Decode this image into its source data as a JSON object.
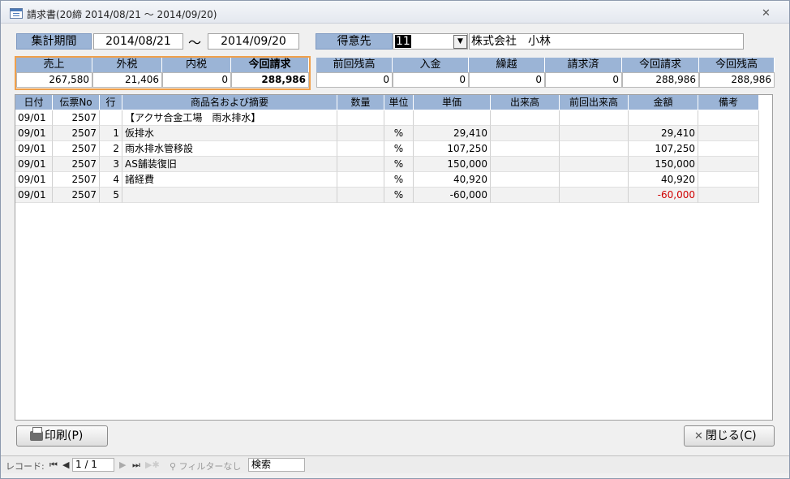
{
  "window": {
    "title": "請求書(20締 2014/08/21 ～ 2014/09/20)",
    "close_glyph": "✕"
  },
  "period": {
    "label": "集計期間",
    "from": "2014/08/21",
    "separator": "～",
    "to": "2014/09/20"
  },
  "customer": {
    "label": "得意先",
    "code": "11",
    "name": "株式会社　小林"
  },
  "summary_left": {
    "headers": [
      "売上",
      "外税",
      "内税",
      "今回請求"
    ],
    "values": [
      "267,580",
      "21,406",
      "0",
      "288,986"
    ]
  },
  "summary_right": {
    "headers": [
      "前回残高",
      "入金",
      "繰越",
      "請求済",
      "今回請求",
      "今回残高"
    ],
    "values": [
      "0",
      "0",
      "0",
      "0",
      "288,986",
      "288,986"
    ]
  },
  "grid": {
    "headers": [
      "日付",
      "伝票No",
      "行",
      "商品名および摘要",
      "数量",
      "単位",
      "単価",
      "出来高",
      "前回出来高",
      "金額",
      "備考"
    ],
    "rows": [
      [
        "09/01",
        "2507",
        "",
        "【アクサ合金工場　雨水排水】",
        "",
        "",
        "",
        "",
        "",
        "",
        ""
      ],
      [
        "09/01",
        "2507",
        "1",
        "仮排水",
        "",
        "%",
        "29,410",
        "",
        "",
        "29,410",
        ""
      ],
      [
        "09/01",
        "2507",
        "2",
        "雨水排水管移設",
        "",
        "%",
        "107,250",
        "",
        "",
        "107,250",
        ""
      ],
      [
        "09/01",
        "2507",
        "3",
        "AS舗装復旧",
        "",
        "%",
        "150,000",
        "",
        "",
        "150,000",
        ""
      ],
      [
        "09/01",
        "2507",
        "4",
        "諸経費",
        "",
        "%",
        "40,920",
        "",
        "",
        "40,920",
        ""
      ],
      [
        "09/01",
        "2507",
        "5",
        "",
        "",
        "%",
        "-60,000",
        "",
        "",
        "-60,000",
        ""
      ]
    ]
  },
  "buttons": {
    "print": "印刷(P)",
    "close": "閉じる(C)"
  },
  "statusbar": {
    "record_label": "レコード:",
    "record_value": "1 / 1",
    "filter": "フィルターなし",
    "search": "検索"
  },
  "colors": {
    "header_blue": "#9bb4d6",
    "highlight_orange": "#f0a04b",
    "negative_red": "#d00000"
  }
}
